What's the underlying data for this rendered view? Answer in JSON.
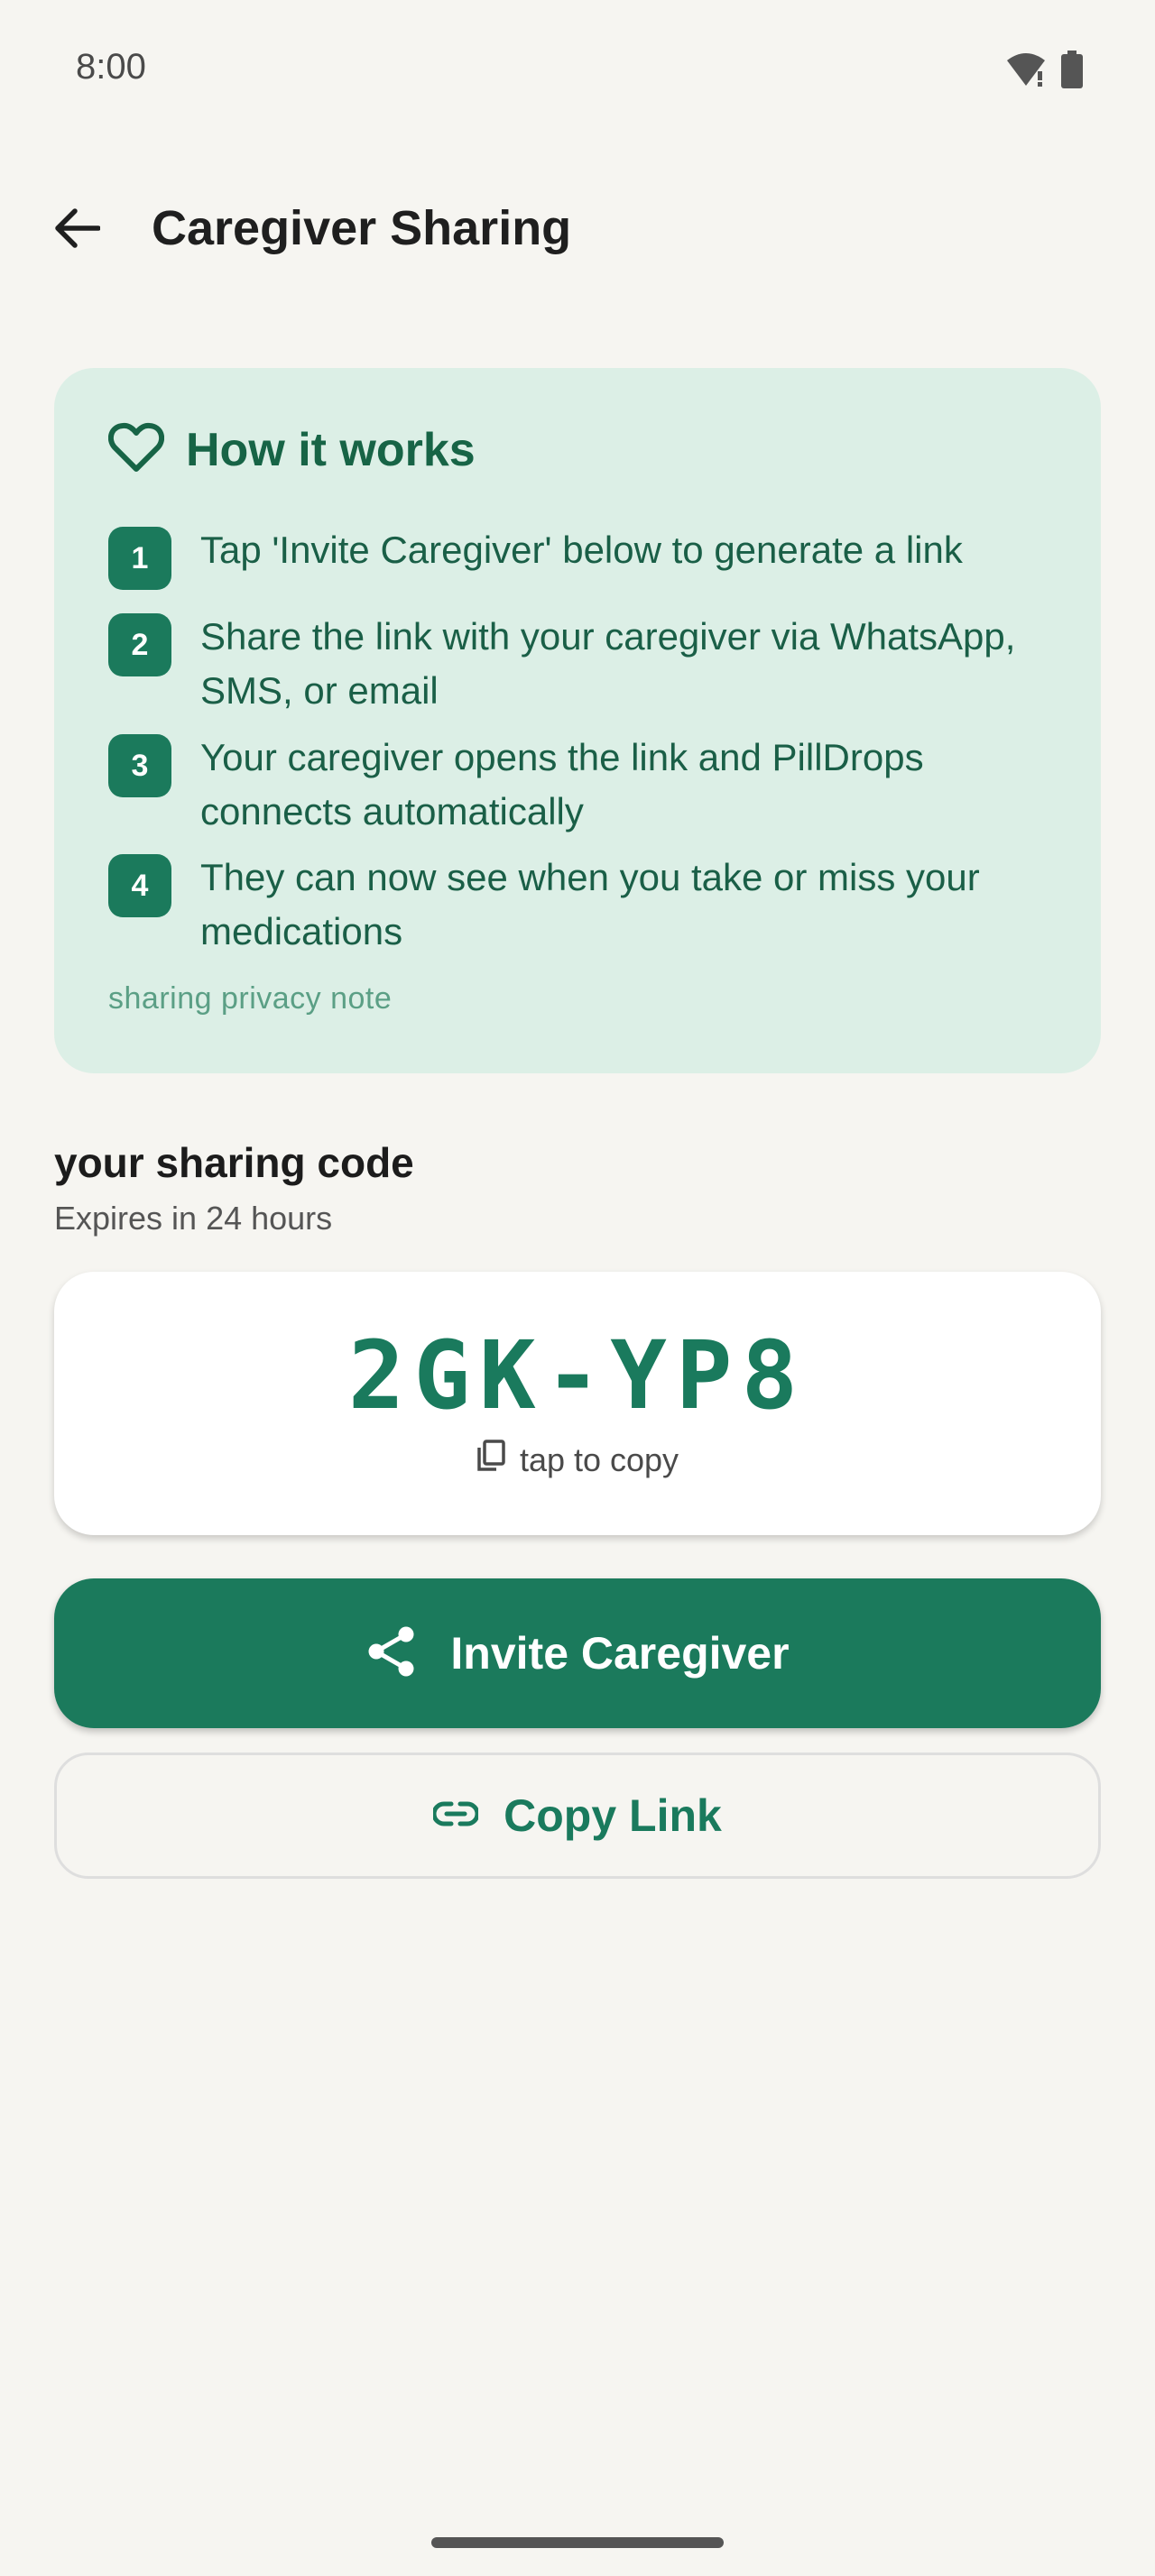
{
  "status_bar": {
    "time": "8:00",
    "icons": [
      "wifi-alert-icon",
      "battery-icon"
    ]
  },
  "header": {
    "title": "Caregiver Sharing",
    "back_icon": "arrow-back-icon"
  },
  "how_it_works": {
    "icon": "heart-outline-icon",
    "title": "How it works",
    "steps": [
      {
        "number": "1",
        "text": "Tap 'Invite Caregiver' below to generate a link"
      },
      {
        "number": "2",
        "text": "Share the link with your caregiver via WhatsApp, SMS, or email"
      },
      {
        "number": "3",
        "text": "Your caregiver opens the link and PillDrops connects automatically"
      },
      {
        "number": "4",
        "text": "They can now see when you take or miss your medications"
      }
    ],
    "privacy_note": "sharing privacy note"
  },
  "sharing_code": {
    "title": "your sharing code",
    "expires": "Expires in 24 hours",
    "code": "2GK-YP8",
    "copy_hint": "tap to copy"
  },
  "actions": {
    "invite_label": "Invite Caregiver",
    "copy_link_label": "Copy Link"
  },
  "colors": {
    "primary": "#1b7a5c",
    "card_background": "#dcefe6",
    "page_background": "#f6f5f1"
  }
}
